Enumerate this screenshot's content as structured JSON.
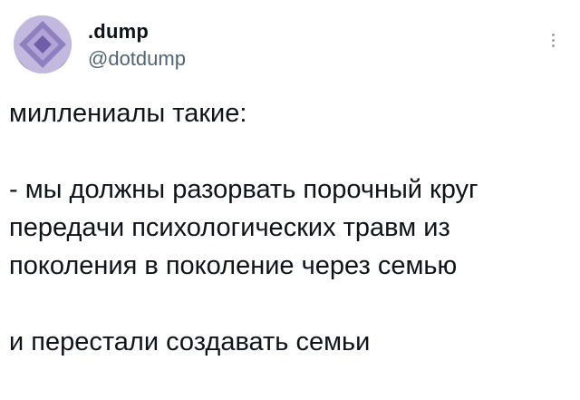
{
  "author": {
    "display_name": ".dump",
    "handle": "@dotdump",
    "avatar_icon": "diamond-pattern-avatar",
    "avatar_color": "#b9aed6"
  },
  "menu": {
    "icon": "more-options-icon"
  },
  "tweet": {
    "lines": [
      "миллениалы такие:",
      "",
      "- мы должны разорвать порочный круг",
      "передачи психологических травм из",
      "поколения в поколение через семью",
      "",
      "и перестали создавать семьи"
    ]
  },
  "colors": {
    "text": "#0f1419",
    "secondary": "#536471"
  }
}
